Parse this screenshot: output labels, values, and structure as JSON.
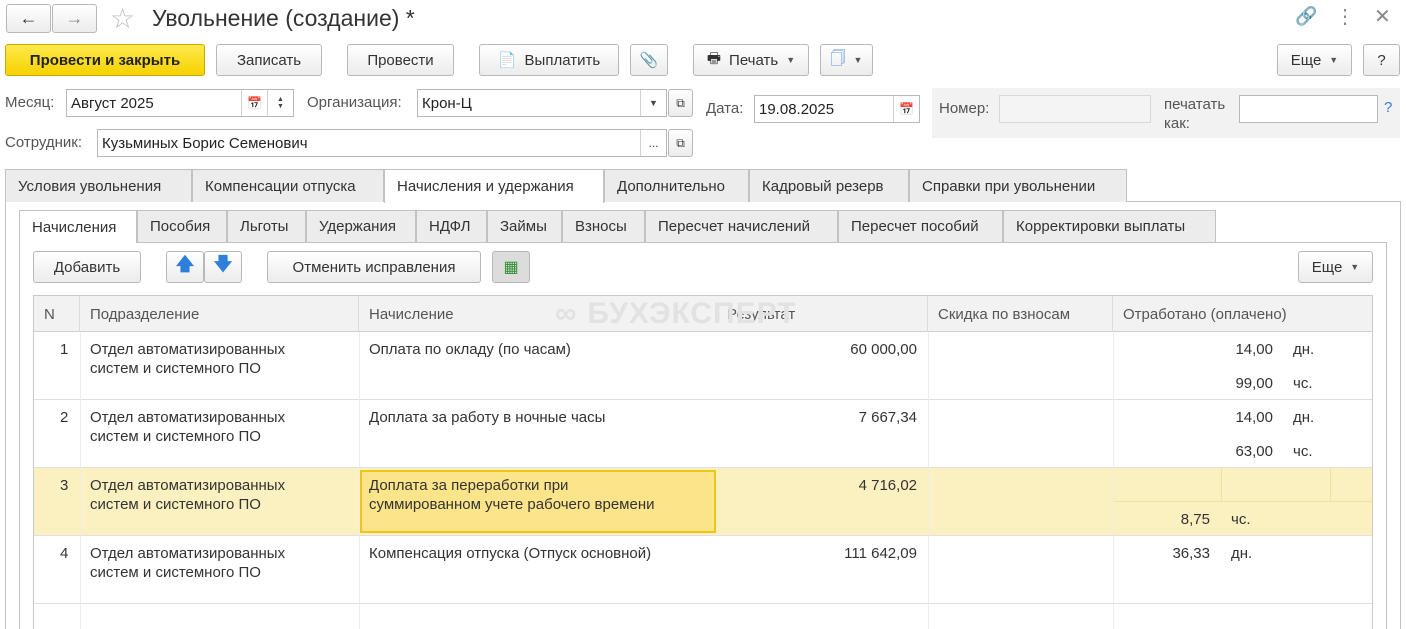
{
  "window": {
    "title": "Увольнение (создание) *"
  },
  "toolbar": {
    "post_close": "Провести и закрыть",
    "save": "Записать",
    "post": "Провести",
    "pay": "Выплатить",
    "print": "Печать",
    "more": "Еще",
    "help": "?"
  },
  "form": {
    "month_label": "Месяц:",
    "month_value": "Август 2025",
    "org_label": "Организация:",
    "org_value": "Крон-Ц",
    "date_label": "Дата:",
    "date_value": "19.08.2025",
    "number_label": "Номер:",
    "number_value": "",
    "print_as_label": "печатать как:",
    "print_as_value": "",
    "employee_label": "Сотрудник:",
    "employee_value": "Кузьминых Борис Семенович",
    "question": "?"
  },
  "tabs_main": [
    "Условия увольнения",
    "Компенсации отпуска",
    "Начисления и удержания",
    "Дополнительно",
    "Кадровый резерв",
    "Справки при увольнении"
  ],
  "tabs_sub": [
    "Начисления",
    "Пособия",
    "Льготы",
    "Удержания",
    "НДФЛ",
    "Займы",
    "Взносы",
    "Пересчет начислений",
    "Пересчет пособий",
    "Корректировки выплаты"
  ],
  "grid_toolbar": {
    "add": "Добавить",
    "cancel_corrections": "Отменить исправления",
    "more": "Еще"
  },
  "watermark": "БУХЭКСПЕРТ",
  "table": {
    "columns": [
      "N",
      "Подразделение",
      "Начисление",
      "Результат",
      "Скидка по взносам",
      "Отработано (оплачено)"
    ],
    "rows": [
      {
        "n": "1",
        "dept_1": "Отдел автоматизированных",
        "dept_2": "систем и системного ПО",
        "accrual_1": "Оплата по окладу (по часам)",
        "accrual_2": "",
        "result": "60 000,00",
        "days": "14,00",
        "days_unit": "дн.",
        "hours": "99,00",
        "hours_unit": "чс."
      },
      {
        "n": "2",
        "dept_1": "Отдел автоматизированных",
        "dept_2": "систем и системного ПО",
        "accrual_1": "Доплата за работу в ночные часы",
        "accrual_2": "",
        "result": "7 667,34",
        "days": "14,00",
        "days_unit": "дн.",
        "hours": "63,00",
        "hours_unit": "чс."
      },
      {
        "n": "3",
        "dept_1": "Отдел автоматизированных",
        "dept_2": "систем и системного ПО",
        "accrual_1": "Доплата за переработки при",
        "accrual_2": "суммированном учете рабочего времени",
        "result": "4 716,02",
        "days": "",
        "days_unit": "",
        "hours": "8,75",
        "hours_unit": "чс."
      },
      {
        "n": "4",
        "dept_1": "Отдел автоматизированных",
        "dept_2": "систем и системного ПО",
        "accrual_1": "Компенсация отпуска (Отпуск основной)",
        "accrual_2": "",
        "result": "111 642,09",
        "days": "36,33",
        "days_unit": "дн.",
        "hours": "",
        "hours_unit": ""
      }
    ]
  }
}
